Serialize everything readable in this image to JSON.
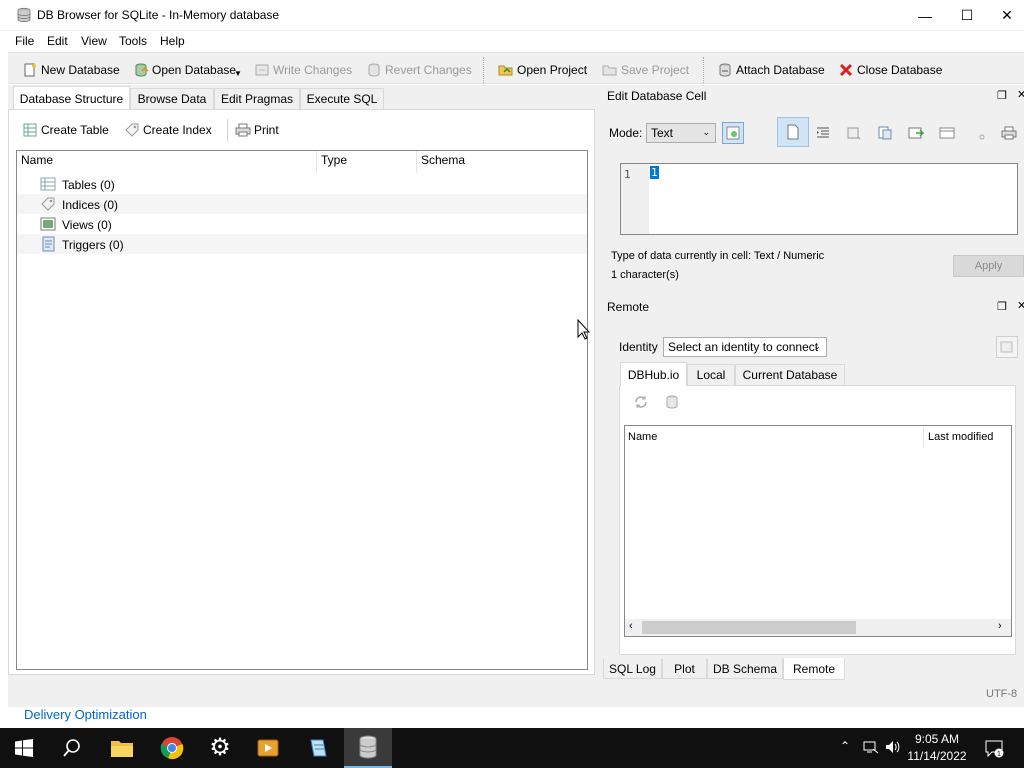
{
  "window": {
    "title": "DB Browser for SQLite - In-Memory database",
    "minimize": "—",
    "maximize": "☐",
    "close": "✕"
  },
  "menu": [
    "File",
    "Edit",
    "View",
    "Tools",
    "Help"
  ],
  "toolbar": {
    "new_database": "New Database",
    "open_database": "Open Database",
    "write_changes": "Write Changes",
    "revert_changes": "Revert Changes",
    "open_project": "Open Project",
    "save_project": "Save Project",
    "attach_database": "Attach Database",
    "close_database": "Close Database"
  },
  "main_tabs": [
    "Database Structure",
    "Browse Data",
    "Edit Pragmas",
    "Execute SQL"
  ],
  "structure_toolbar": {
    "create_table": "Create Table",
    "create_index": "Create Index",
    "print": "Print"
  },
  "tree": {
    "columns": [
      "Name",
      "Type",
      "Schema"
    ],
    "rows": [
      "Tables (0)",
      "Indices (0)",
      "Views (0)",
      "Triggers (0)"
    ]
  },
  "edit_cell": {
    "header": "Edit Database Cell",
    "mode_label": "Mode:",
    "mode_value": "Text",
    "line_number": "1",
    "cell_value": "1",
    "type_info": "Type of data currently in cell: Text / Numeric",
    "char_count": "1 character(s)",
    "apply": "Apply"
  },
  "remote": {
    "header": "Remote",
    "identity_label": "Identity",
    "identity_placeholder": "Select an identity to connect",
    "tabs": [
      "DBHub.io",
      "Local",
      "Current Database"
    ],
    "columns": [
      "Name",
      "Last modified"
    ]
  },
  "bottom_tabs": [
    "SQL Log",
    "Plot",
    "DB Schema",
    "Remote"
  ],
  "status": {
    "encoding": "UTF-8"
  },
  "desktop_label": "Delivery Optimization",
  "taskbar": {
    "time": "9:05 AM",
    "date": "11/14/2022"
  },
  "colors": {
    "selection": "#0078d7",
    "close_red": "#e81123",
    "taskbar": "#101010",
    "link_blue": "#0066cc"
  }
}
